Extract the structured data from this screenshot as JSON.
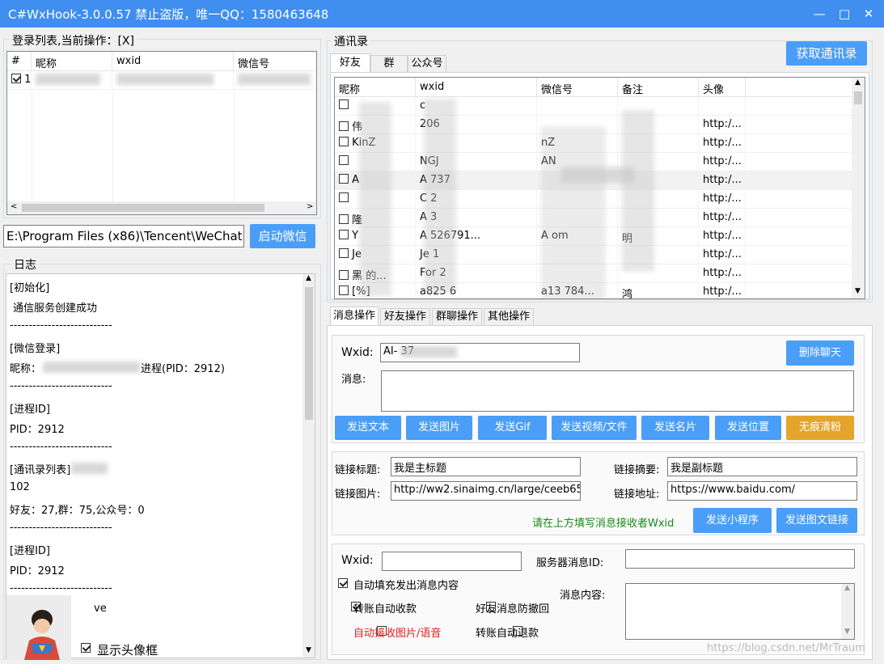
{
  "window": {
    "title": "C#WxHook-3.0.0.57    禁止盗版，唯一QQ：1580463648",
    "min": "—",
    "max": "□",
    "close": "✕"
  },
  "login": {
    "group_title": "登录列表,当前操作：[X]",
    "columns": [
      "#",
      "昵称",
      "wxid",
      "微信号"
    ],
    "row": {
      "index": "1",
      "checked": true
    }
  },
  "launcher": {
    "path": "E:\\Program Files (x86)\\Tencent\\WeChat",
    "start_label": "启动微信"
  },
  "log": {
    "group_title": "日志",
    "lines": [
      "[初始化]",
      "通信服务创建成功",
      "---------------------------",
      "[微信登录]",
      "昵称：",
      "进程(PID：2912)",
      "---------------------------",
      "[进程ID]",
      "PID：2912",
      "---------------------------",
      "[通讯录列表]",
      "102",
      "好友：27,群：75,公众号：0",
      "---------------------------",
      "[进程ID]",
      "PID：2912",
      "---------------------------",
      "ve"
    ],
    "avatar_label": "显示头像框",
    "avatar_checked": true
  },
  "contacts": {
    "group_title": "通讯录",
    "fetch_label": "获取通讯录",
    "tabs": [
      "好友",
      "群",
      "公众号"
    ],
    "columns": [
      "昵称",
      "wxid",
      "微信号",
      "备注",
      "头像"
    ],
    "rows": [
      {
        "nick": "",
        "wxid": "c",
        "wxno": "",
        "remark": "",
        "avatar": ""
      },
      {
        "nick": "伟",
        "wxid": "206",
        "wxno": "",
        "remark": "",
        "avatar": "http:/..."
      },
      {
        "nick": "KinZ",
        "wxid": "",
        "wxno": "nZ",
        "remark": "",
        "avatar": "http:/..."
      },
      {
        "nick": "",
        "wxid": "NGJ",
        "wxno": "AN",
        "remark": "",
        "avatar": "http:/..."
      },
      {
        "nick": "A",
        "wxid": "A  737",
        "wxno": "",
        "remark": "",
        "avatar": "http:/..."
      },
      {
        "nick": "",
        "wxid": "C  2",
        "wxno": "",
        "remark": "",
        "avatar": "http:/..."
      },
      {
        "nick": "隆",
        "wxid": "A  3",
        "wxno": "",
        "remark": "",
        "avatar": "http:/..."
      },
      {
        "nick": "Y",
        "wxid": "A  526791...",
        "wxno": "A  om",
        "remark": "明",
        "avatar": "http:/..."
      },
      {
        "nick": "Je",
        "wxid": "Je  1",
        "wxno": "",
        "remark": "",
        "avatar": "http:/..."
      },
      {
        "nick": "黑  的...",
        "wxid": "For  2",
        "wxno": "",
        "remark": "",
        "avatar": "http:/..."
      },
      {
        "nick": "[%]",
        "wxid": "a825  6",
        "wxno": "a13  784...",
        "remark": "鸿",
        "avatar": "http:/..."
      }
    ]
  },
  "ops": {
    "tabs": [
      "消息操作",
      "好友操作",
      "群聊操作",
      "其他操作"
    ],
    "msg": {
      "wxid_label": "Wxid:",
      "wxid_value": "AI-  37",
      "msg_label": "消息:",
      "delete_label": "删除聊天",
      "buttons": [
        "发送文本",
        "发送图片",
        "发送Gif",
        "发送视频/文件",
        "发送名片",
        "发送位置",
        "无痕清粉"
      ]
    },
    "link": {
      "title_label": "链接标题:",
      "title_value": "我是主标题",
      "summary_label": "链接摘要:",
      "summary_value": "我是副标题",
      "image_label": "链接图片:",
      "image_value": "http://ww2.sinaimg.cn/large/ceeb653",
      "url_label": "链接地址:",
      "url_value": "https://www.baidu.com/",
      "hint": "请在上方填写消息接收者Wxid",
      "mini_label": "发送小程序",
      "link_label": "发送图文链接"
    },
    "server": {
      "wxid_label": "Wxid:",
      "msgid_label": "服务器消息ID:",
      "content_label": "消息内容:",
      "auto_fill": "自动填充发出消息内容",
      "auto_recv": "转账自动收款",
      "anti_revoke": "好友消息防撤回",
      "auto_img": "自动接收图片/语音",
      "auto_refund": "转账自动退款"
    }
  },
  "watermark": "https://blog.csdn.net/MrTraum",
  "colors": {
    "titlebar": "#3f8ef0",
    "button": "#4a9ef7",
    "orange": "#e5a42b",
    "hint_green": "#1a8a1a",
    "red": "#e02020"
  }
}
